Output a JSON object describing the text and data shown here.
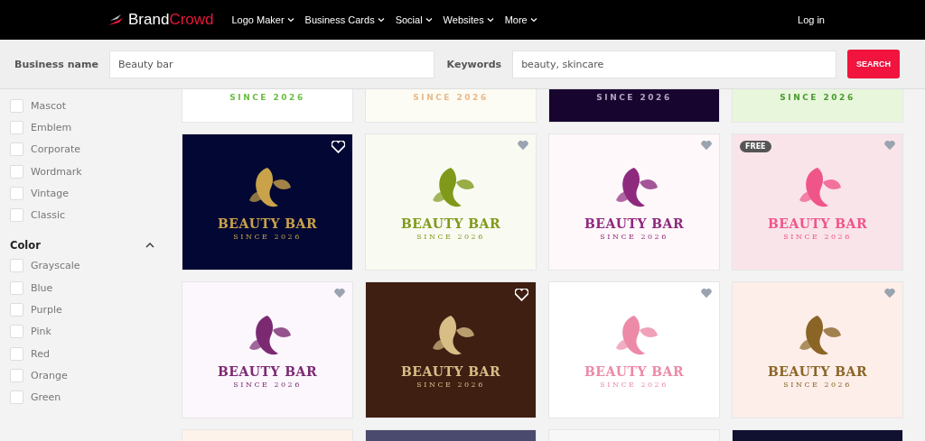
{
  "nav": {
    "logo": {
      "first": "Brand",
      "second": "Crowd"
    },
    "items": [
      {
        "label": "Logo Maker"
      },
      {
        "label": "Business Cards"
      },
      {
        "label": "Social"
      },
      {
        "label": "Websites"
      },
      {
        "label": "More"
      }
    ],
    "login": "Log in"
  },
  "search": {
    "business_label": "Business name",
    "business_value": "Beauty bar",
    "keywords_label": "Keywords",
    "keywords_value": "beauty, skincare",
    "button": "SEARCH"
  },
  "sidebar": {
    "style_items": [
      {
        "label": "Mascot",
        "checked": false
      },
      {
        "label": "Emblem",
        "checked": false
      },
      {
        "label": "Corporate",
        "checked": false
      },
      {
        "label": "Wordmark",
        "checked": false
      },
      {
        "label": "Vintage",
        "checked": false
      },
      {
        "label": "Classic",
        "checked": false
      }
    ],
    "color_section": {
      "title": "Color",
      "expanded": true,
      "items": [
        {
          "label": "Grayscale",
          "checked": false
        },
        {
          "label": "Blue",
          "checked": false
        },
        {
          "label": "Purple",
          "checked": false
        },
        {
          "label": "Pink",
          "checked": false
        },
        {
          "label": "Red",
          "checked": false
        },
        {
          "label": "Orange",
          "checked": false
        },
        {
          "label": "Green",
          "checked": false
        }
      ]
    }
  },
  "cards": [
    {
      "kind": "top_cut",
      "color": "#ffffff",
      "logo": {
        "color": "#6cbd45",
        "subtitle": "SINCE 2026"
      }
    },
    {
      "kind": "top_cut",
      "color": "#fdfcf4",
      "logo": {
        "color": "#e8b98a",
        "subtitle": "SINCE 2026"
      }
    },
    {
      "kind": "top_cut",
      "color": "#170530",
      "logo": {
        "color": "#b5a3c0",
        "subtitle": "SINCE 2026"
      }
    },
    {
      "kind": "top_cut",
      "color": "#e8f7dc",
      "logo": {
        "color": "#4a9a30",
        "subtitle": "SINCE 2026"
      }
    },
    {
      "kind": "full",
      "color": "#020833",
      "logo": {
        "color": "#c9a24a",
        "title": "BEAUTY BAR",
        "subtitle": "SINCE 2026"
      },
      "heart": {
        "kind": "outline"
      },
      "free": false
    },
    {
      "kind": "full",
      "color": "#f9faf2",
      "logo": {
        "color": "#7f9a1a",
        "title": "BEAUTY BAR",
        "subtitle": "SINCE 2026"
      },
      "heart": {
        "kind": "filled"
      },
      "free": false
    },
    {
      "kind": "full",
      "color": "#fff8fa",
      "logo": {
        "color": "#8e2a7e",
        "title": "BEAUTY BAR",
        "subtitle": "SINCE 2026"
      },
      "heart": {
        "kind": "filled"
      },
      "free": false
    },
    {
      "kind": "full",
      "color": "#f9e4ea",
      "logo": {
        "color": "#f0558a",
        "title": "BEAUTY BAR",
        "subtitle": "SINCE 2026"
      },
      "heart": {
        "kind": "filled"
      },
      "free": true,
      "badge": "FREE"
    },
    {
      "kind": "full",
      "color": "#fcf6fd",
      "logo": {
        "color": "#7b2a72",
        "title": "BEAUTY BAR",
        "subtitle": "SINCE 2026"
      },
      "heart": {
        "kind": "filled"
      },
      "free": false
    },
    {
      "kind": "full",
      "color": "#3e1f12",
      "logo": {
        "color": "#d8bd86",
        "title": "BEAUTY BAR",
        "subtitle": "SINCE 2026"
      },
      "heart": {
        "kind": "outline"
      },
      "free": false
    },
    {
      "kind": "full",
      "color": "#ffffff",
      "logo": {
        "color": "#ec8aa8",
        "title": "BEAUTY BAR",
        "subtitle": "SINCE 2026"
      },
      "heart": {
        "kind": "filled"
      },
      "free": false
    },
    {
      "kind": "full",
      "color": "#fdeeea",
      "logo": {
        "color": "#8a6526",
        "title": "BEAUTY BAR",
        "subtitle": "SINCE 2026"
      },
      "heart": {
        "kind": "filled"
      },
      "free": false
    },
    {
      "kind": "bottom_cut",
      "color": "#fdf3ea"
    },
    {
      "kind": "bottom_cut",
      "color": "#4a4a6e"
    },
    {
      "kind": "bottom_cut",
      "color": "#f7f7f7"
    },
    {
      "kind": "bottom_cut",
      "color": "#101030"
    }
  ]
}
